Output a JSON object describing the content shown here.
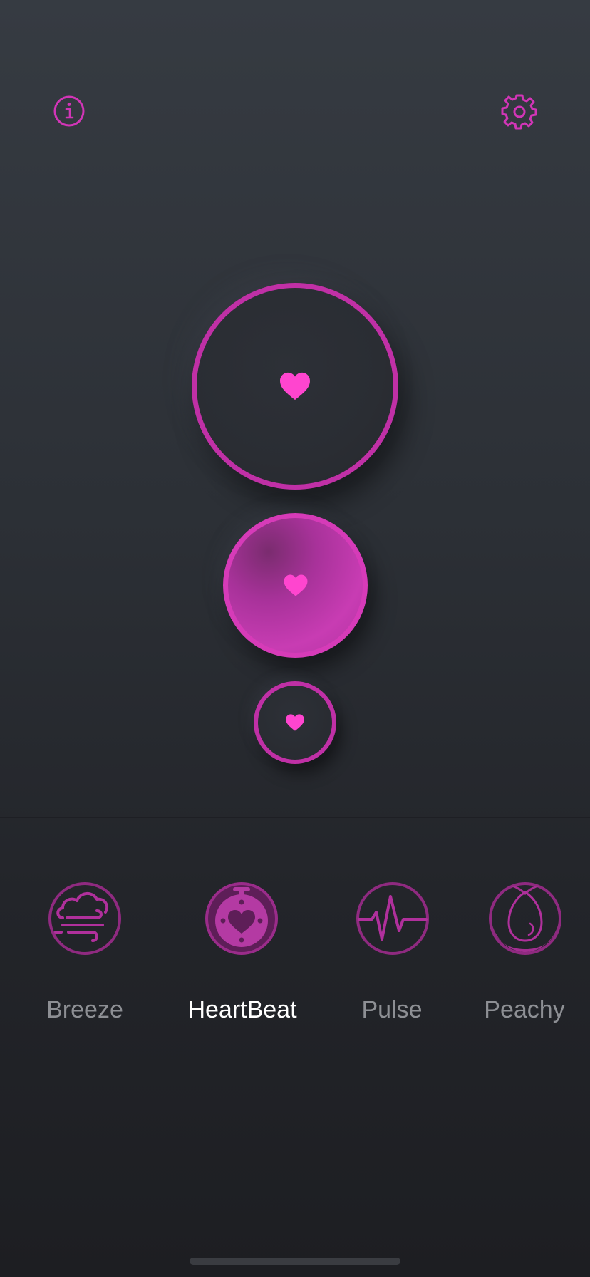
{
  "app": {
    "accent_color": "#c030a6",
    "heart_color": "#ff45cf",
    "background_top": "#363b42",
    "background_bottom": "#1d1e22"
  },
  "header": {
    "left_icon": "info-icon",
    "right_icon": "gear-icon"
  },
  "intensity_buttons": [
    {
      "size": "large",
      "icon": "heart-icon",
      "selected": false
    },
    {
      "size": "medium",
      "icon": "heart-icon",
      "selected": true
    },
    {
      "size": "small",
      "icon": "heart-icon",
      "selected": false
    }
  ],
  "modes": [
    {
      "label": "Breeze",
      "icon": "cloud-wind-icon",
      "active": false
    },
    {
      "label": "HeartBeat",
      "icon": "heart-timer-icon",
      "active": true
    },
    {
      "label": "Pulse",
      "icon": "pulse-wave-icon",
      "active": false
    },
    {
      "label": "Peachy",
      "icon": "peach-icon",
      "active": false
    }
  ]
}
